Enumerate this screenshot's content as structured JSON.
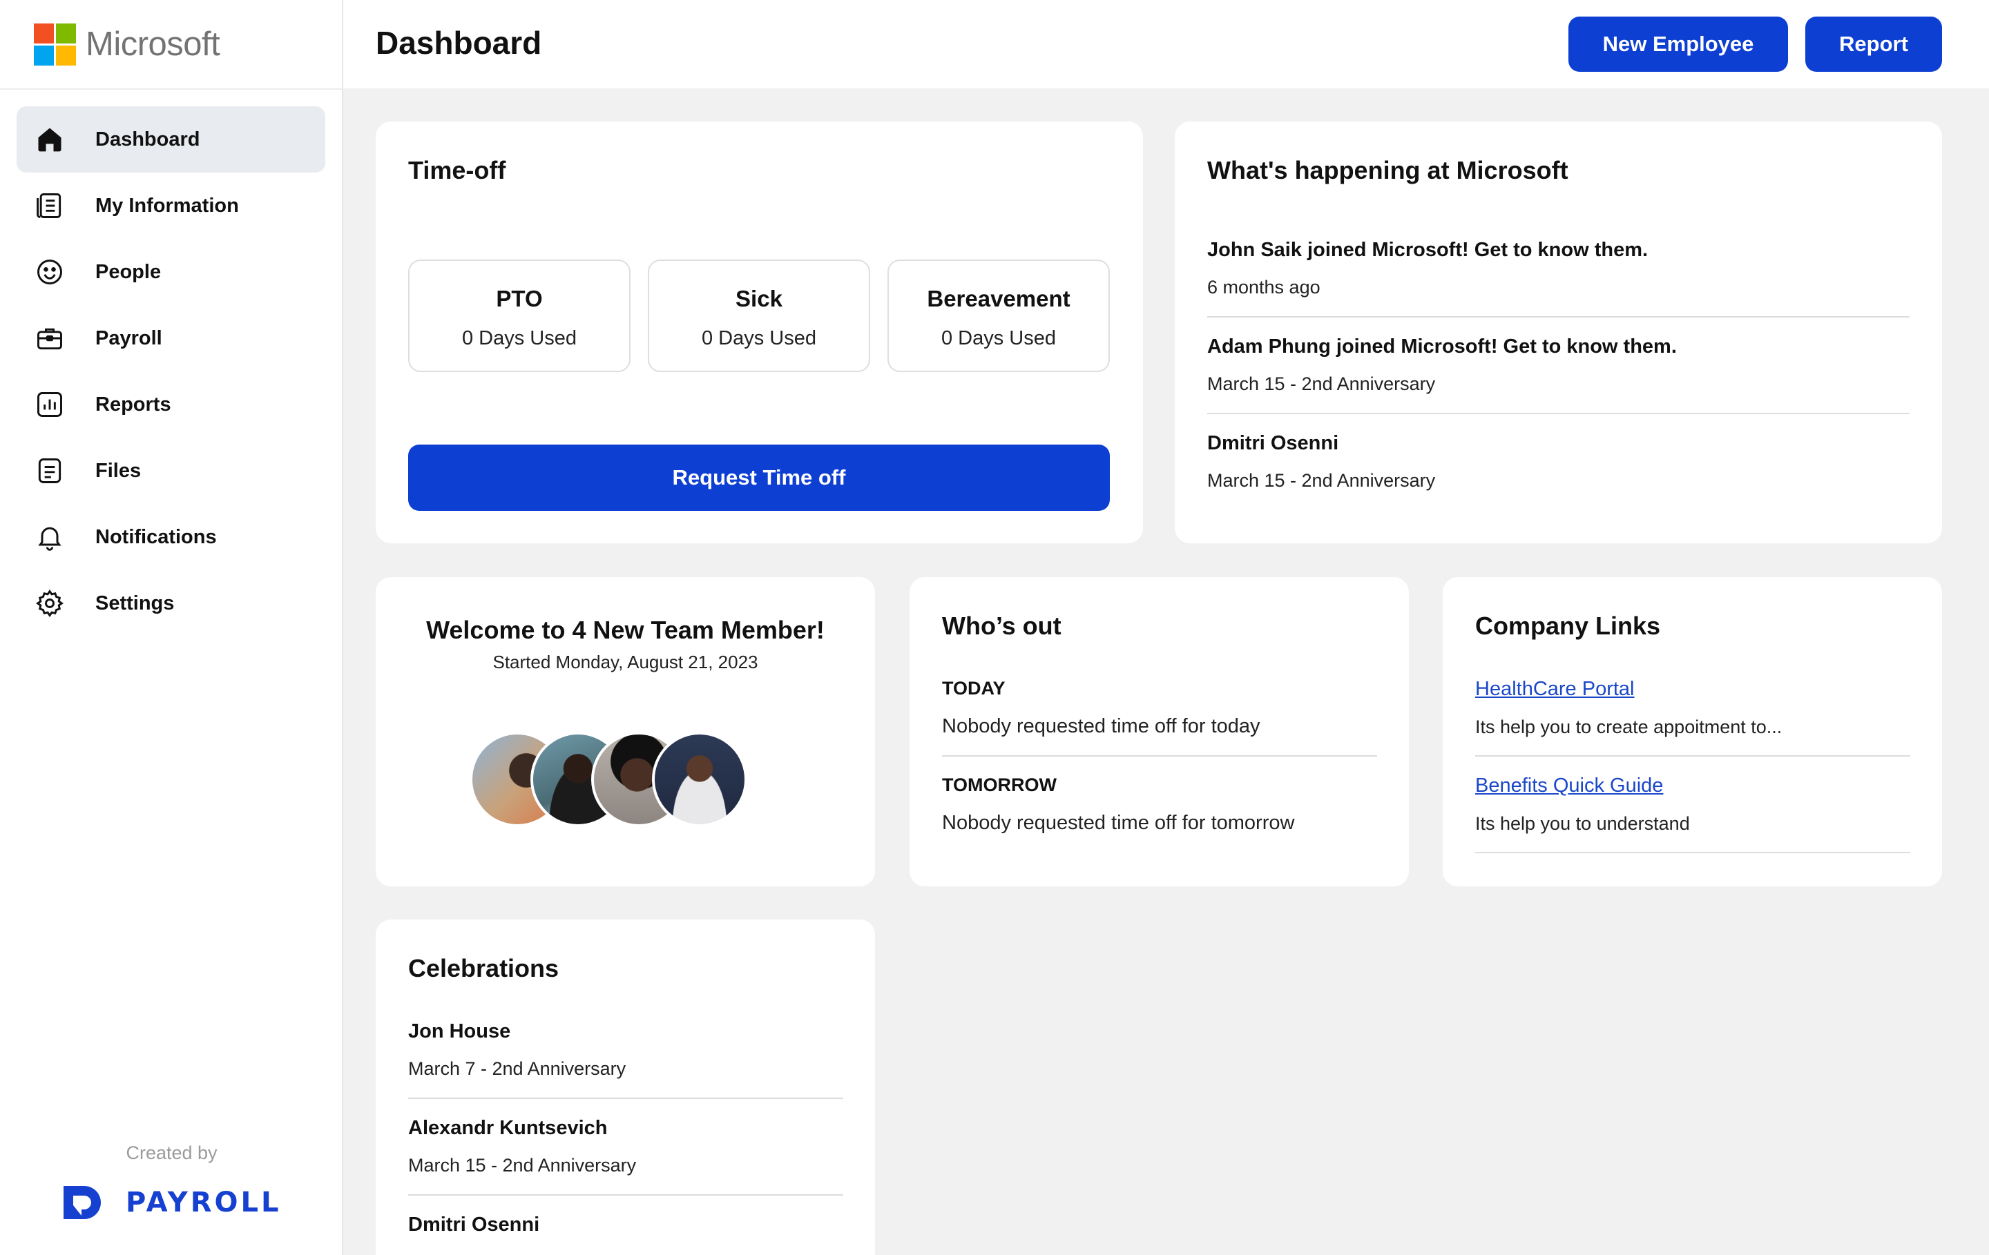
{
  "brand": {
    "name": "Microsoft",
    "colors": [
      "#f25022",
      "#7fba00",
      "#00a4ef",
      "#ffb900"
    ]
  },
  "header": {
    "title": "Dashboard",
    "new_employee_label": "New Employee",
    "report_label": "Report"
  },
  "accent": "#0e3fd3",
  "sidebar": {
    "items": [
      {
        "label": "Dashboard",
        "icon": "home-icon",
        "active": true
      },
      {
        "label": "My Information",
        "icon": "document-list-icon"
      },
      {
        "label": "People",
        "icon": "smiley-icon"
      },
      {
        "label": "Payroll",
        "icon": "briefcase-icon"
      },
      {
        "label": "Reports",
        "icon": "bar-chart-icon"
      },
      {
        "label": "Files",
        "icon": "file-icon"
      },
      {
        "label": "Notifications",
        "icon": "bell-icon"
      },
      {
        "label": "Settings",
        "icon": "gear-icon"
      }
    ],
    "created_by": "Created by",
    "payroll_brand": "PAYROLL"
  },
  "timeoff": {
    "title": "Time-off",
    "boxes": [
      {
        "title": "PTO",
        "used": "0 Days Used"
      },
      {
        "title": "Sick",
        "used": "0 Days Used"
      },
      {
        "title": "Bereavement",
        "used": "0 Days Used"
      }
    ],
    "request_label": "Request Time off"
  },
  "happening": {
    "title": "What's happening at Microsoft",
    "items": [
      {
        "title": "John Saik joined Microsoft! Get to know them.",
        "sub": "6 months ago"
      },
      {
        "title": "Adam Phung joined Microsoft! Get to know them.",
        "sub": "March 15 - 2nd Anniversary"
      },
      {
        "title": "Dmitri Osenni",
        "sub": "March 15 - 2nd Anniversary"
      }
    ]
  },
  "welcome": {
    "title": "Welcome to 4 New Team Member!",
    "subtitle": "Started Monday, August 21, 2023"
  },
  "whos_out": {
    "title": "Who’s out",
    "today_label": "TODAY",
    "today_text": "Nobody requested time off for today",
    "tomorrow_label": "TOMORROW",
    "tomorrow_text": "Nobody requested time off for tomorrow"
  },
  "company_links": {
    "title": "Company Links",
    "links": [
      {
        "label": "HealthCare Portal",
        "desc": "Its help you to create appoitment to..."
      },
      {
        "label": "Benefits Quick Guide",
        "desc": "Its help you to understand"
      }
    ]
  },
  "celebrations": {
    "title": "Celebrations",
    "items": [
      {
        "name": "Jon House",
        "sub": "March 7 - 2nd Anniversary"
      },
      {
        "name": "Alexandr Kuntsevich",
        "sub": "March 15 - 2nd Anniversary"
      },
      {
        "name": "Dmitri Osenni",
        "sub": ""
      }
    ]
  }
}
